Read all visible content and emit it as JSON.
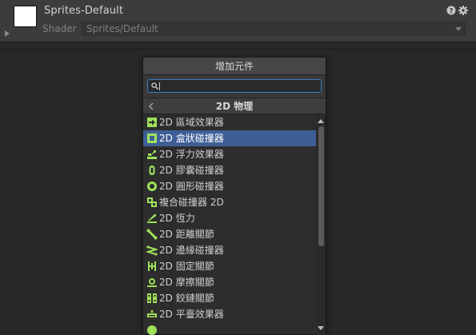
{
  "inspector": {
    "material_name": "Sprites-Default",
    "shader_label": "Shader",
    "shader_value": "Sprites/Default",
    "icons": [
      "help-icon",
      "gear-icon"
    ]
  },
  "popup": {
    "title": "增加元件",
    "search": {
      "value": "",
      "icon": "search-icon"
    },
    "category": "2D 物理",
    "items": [
      {
        "label": "2D 區域效果器",
        "icon": "area-effector-icon",
        "selected": false
      },
      {
        "label": "2D 盒狀碰撞器",
        "icon": "box-collider-icon",
        "selected": true
      },
      {
        "label": "2D 浮力效果器",
        "icon": "buoyancy-effector-icon",
        "selected": false
      },
      {
        "label": "2D 膠囊碰撞器",
        "icon": "capsule-collider-icon",
        "selected": false
      },
      {
        "label": "2D 圓形碰撞器",
        "icon": "circle-collider-icon",
        "selected": false
      },
      {
        "label": "複合碰撞器 2D",
        "icon": "composite-collider-icon",
        "selected": false
      },
      {
        "label": "2D 恆力",
        "icon": "constant-force-icon",
        "selected": false
      },
      {
        "label": "2D 距離關節",
        "icon": "distance-joint-icon",
        "selected": false
      },
      {
        "label": "2D 邊緣碰撞器",
        "icon": "edge-collider-icon",
        "selected": false
      },
      {
        "label": "2D 固定關節",
        "icon": "fixed-joint-icon",
        "selected": false
      },
      {
        "label": "2D 摩擦關節",
        "icon": "friction-joint-icon",
        "selected": false
      },
      {
        "label": "2D 鉸鏈關節",
        "icon": "hinge-joint-icon",
        "selected": false
      },
      {
        "label": "2D 平臺效果器",
        "icon": "platform-effector-icon",
        "selected": false
      },
      {
        "label": "",
        "icon": "point-effector-icon",
        "selected": false
      }
    ]
  },
  "colors": {
    "accent_icon": "#9fe15b",
    "selection": "#3e5f96",
    "search_border": "#3d7ec2"
  }
}
